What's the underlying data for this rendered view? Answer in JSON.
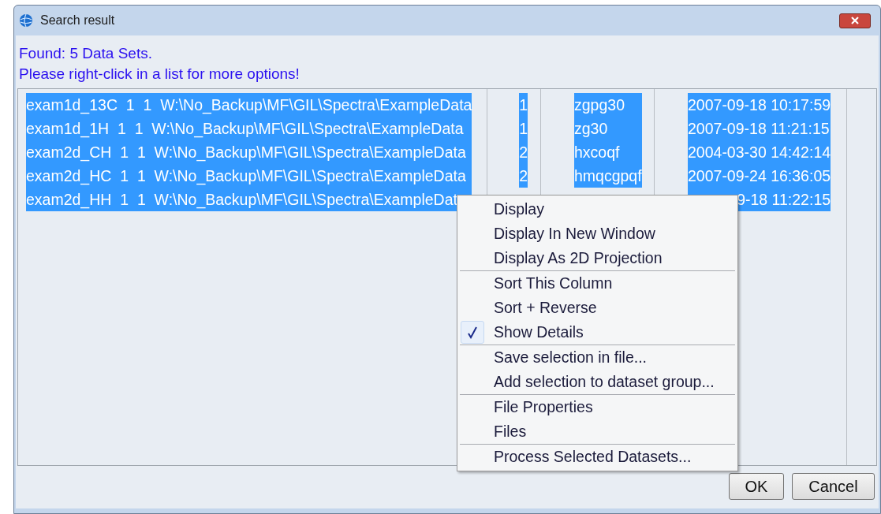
{
  "window": {
    "title": "Search result"
  },
  "header": [
    "Found: 5 Data Sets.",
    "Please right-click in a list for more options!"
  ],
  "rows": [
    {
      "selected": true,
      "cells": [
        "exam1d_13C  1  1  W:\\No_Backup\\MF\\GIL\\Spectra\\ExampleData",
        "1",
        "zgpg30",
        "2007-09-18 10:17:59"
      ]
    },
    {
      "selected": true,
      "cells": [
        "exam1d_1H  1  1  W:\\No_Backup\\MF\\GIL\\Spectra\\ExampleData",
        "1",
        "zg30",
        "2007-09-18 11:21:15"
      ]
    },
    {
      "selected": true,
      "cells": [
        "exam2d_CH  1  1  W:\\No_Backup\\MF\\GIL\\Spectra\\ExampleData",
        "2",
        "hxcoqf",
        "2004-03-30 14:42:14"
      ]
    },
    {
      "selected": true,
      "cells": [
        "exam2d_HC  1  1  W:\\No_Backup\\MF\\GIL\\Spectra\\ExampleData",
        "2",
        "hmqcgpqf",
        "2007-09-24 16:36:05"
      ]
    },
    {
      "selected": true,
      "cells": [
        "exam2d_HH  1  1  W:\\No_Backup\\MF\\GIL\\Spectra\\ExampleDat",
        null,
        null,
        "9-18 11:22:15"
      ]
    }
  ],
  "context_menu": [
    [
      {
        "label": "Display",
        "checked": false
      },
      {
        "label": "Display In New Window",
        "checked": false
      },
      {
        "label": "Display As 2D Projection",
        "checked": false
      }
    ],
    [
      {
        "label": "Sort This Column",
        "checked": false
      },
      {
        "label": "Sort + Reverse",
        "checked": false
      },
      {
        "label": "Show Details",
        "checked": true
      }
    ],
    [
      {
        "label": "Save selection in file...",
        "checked": false
      },
      {
        "label": "Add selection to dataset group...",
        "checked": false
      }
    ],
    [
      {
        "label": "File Properties",
        "checked": false
      },
      {
        "label": "Files",
        "checked": false
      }
    ],
    [
      {
        "label": "Process Selected Datasets...",
        "checked": false
      }
    ]
  ],
  "buttons": [
    "OK",
    "Cancel"
  ]
}
